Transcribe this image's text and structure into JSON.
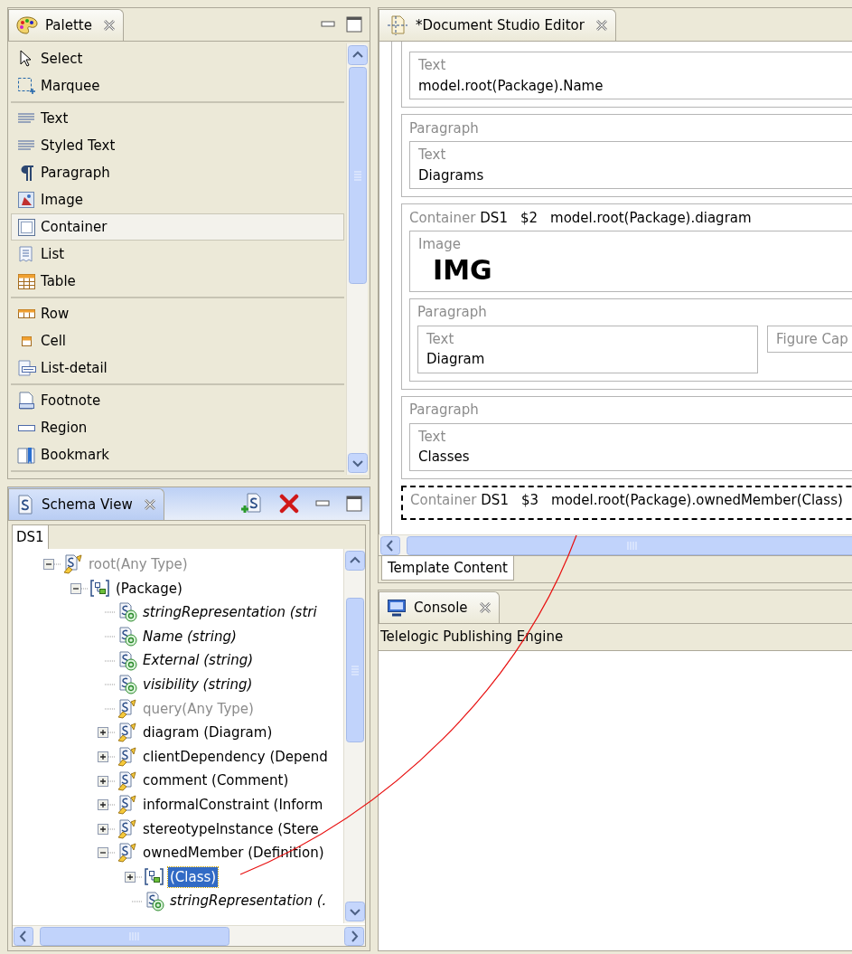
{
  "palette": {
    "title": "Palette",
    "active": false,
    "groups": [
      {
        "items": [
          {
            "kind": "select",
            "label": "Select",
            "selected": false
          },
          {
            "kind": "marquee",
            "label": "Marquee",
            "selected": false
          }
        ]
      },
      {
        "items": [
          {
            "kind": "text",
            "label": "Text",
            "selected": false
          },
          {
            "kind": "text",
            "label": "Styled Text",
            "selected": false
          },
          {
            "kind": "paragraph",
            "label": "Paragraph",
            "selected": false
          },
          {
            "kind": "image",
            "label": "Image",
            "selected": false
          },
          {
            "kind": "container",
            "label": "Container",
            "selected": true
          },
          {
            "kind": "list",
            "label": "List",
            "selected": false
          },
          {
            "kind": "table",
            "label": "Table",
            "selected": false
          }
        ]
      },
      {
        "items": [
          {
            "kind": "row",
            "label": "Row",
            "selected": false
          },
          {
            "kind": "cell",
            "label": "Cell",
            "selected": false
          },
          {
            "kind": "listdetail",
            "label": "List-detail",
            "selected": false
          }
        ]
      },
      {
        "items": [
          {
            "kind": "footnote",
            "label": "Footnote",
            "selected": false
          },
          {
            "kind": "region",
            "label": "Region",
            "selected": false
          },
          {
            "kind": "bookmark",
            "label": "Bookmark",
            "selected": false
          }
        ]
      }
    ]
  },
  "schema_view": {
    "title": "Schema View",
    "active": true,
    "tabs": [
      {
        "label": "DS1",
        "selected": true
      }
    ],
    "tree": [
      {
        "kind": "query",
        "label": "root(Any Type)",
        "disabled": true,
        "expanded": true,
        "selected": false,
        "children": [
          {
            "kind": "type",
            "label": "(Package)",
            "disabled": false,
            "expanded": true,
            "selected": false,
            "children": [
              {
                "kind": "attribute",
                "label": "stringRepresentation (stri",
                "disabled": false,
                "selected": false
              },
              {
                "kind": "attribute",
                "label": "Name (string)",
                "disabled": false,
                "selected": false
              },
              {
                "kind": "attribute",
                "label": "External (string)",
                "disabled": false,
                "selected": false
              },
              {
                "kind": "attribute",
                "label": "visibility (string)",
                "disabled": false,
                "selected": false
              },
              {
                "kind": "query",
                "label": "query(Any Type)",
                "disabled": true,
                "selected": false
              },
              {
                "kind": "query",
                "label": "diagram (Diagram)",
                "disabled": false,
                "expanded": false,
                "selected": false
              },
              {
                "kind": "query",
                "label": "clientDependency (Depend",
                "disabled": false,
                "expanded": false,
                "selected": false
              },
              {
                "kind": "query",
                "label": "comment (Comment)",
                "disabled": false,
                "expanded": false,
                "selected": false
              },
              {
                "kind": "query",
                "label": "informalConstraint (Inform",
                "disabled": false,
                "expanded": false,
                "selected": false
              },
              {
                "kind": "query",
                "label": "stereotypeInstance (Stere",
                "disabled": false,
                "expanded": false,
                "selected": false
              },
              {
                "kind": "query",
                "label": "ownedMember (Definition)",
                "disabled": false,
                "expanded": true,
                "selected": false,
                "children": [
                  {
                    "kind": "type",
                    "label": "(Class)",
                    "disabled": false,
                    "expanded": false,
                    "selected": true
                  },
                  {
                    "kind": "attribute",
                    "label": "stringRepresentation (.",
                    "disabled": false,
                    "selected": false
                  }
                ]
              }
            ]
          }
        ]
      }
    ]
  },
  "editor": {
    "title": "*Document Studio Editor",
    "blocks": [
      {
        "kind": "paragraph",
        "selected": false,
        "children": [
          {
            "kind": "text",
            "label": "Text",
            "value": "model.root(Package).Name"
          }
        ]
      },
      {
        "kind": "paragraph",
        "label": "Paragraph",
        "selected": false,
        "children": [
          {
            "kind": "text",
            "label": "Text",
            "value": "Diagrams"
          }
        ]
      },
      {
        "kind": "container",
        "label": "Container",
        "source": "DS1",
        "variable": "$2",
        "expression": "model.root(Package).diagram",
        "selected": false,
        "children": [
          {
            "kind": "image",
            "label": "Image",
            "value": "IMG"
          },
          {
            "kind": "paragraph",
            "label": "Paragraph",
            "selected": false,
            "children": [
              {
                "kind": "text",
                "label": "Text",
                "value": "Diagram"
              },
              {
                "kind": "caption",
                "label": "Figure Cap"
              }
            ]
          }
        ]
      },
      {
        "kind": "paragraph",
        "label": "Paragraph",
        "selected": false,
        "children": [
          {
            "kind": "text",
            "label": "Text",
            "value": "Classes"
          }
        ]
      },
      {
        "kind": "container",
        "label": "Container",
        "source": "DS1",
        "variable": "$3",
        "expression": "model.root(Package).ownedMember(Class)",
        "selected": true
      }
    ],
    "bottom_tabs": [
      {
        "label": "Template Content",
        "selected": true
      }
    ]
  },
  "console": {
    "title": "Console",
    "text": "Telelogic Publishing Engine"
  }
}
